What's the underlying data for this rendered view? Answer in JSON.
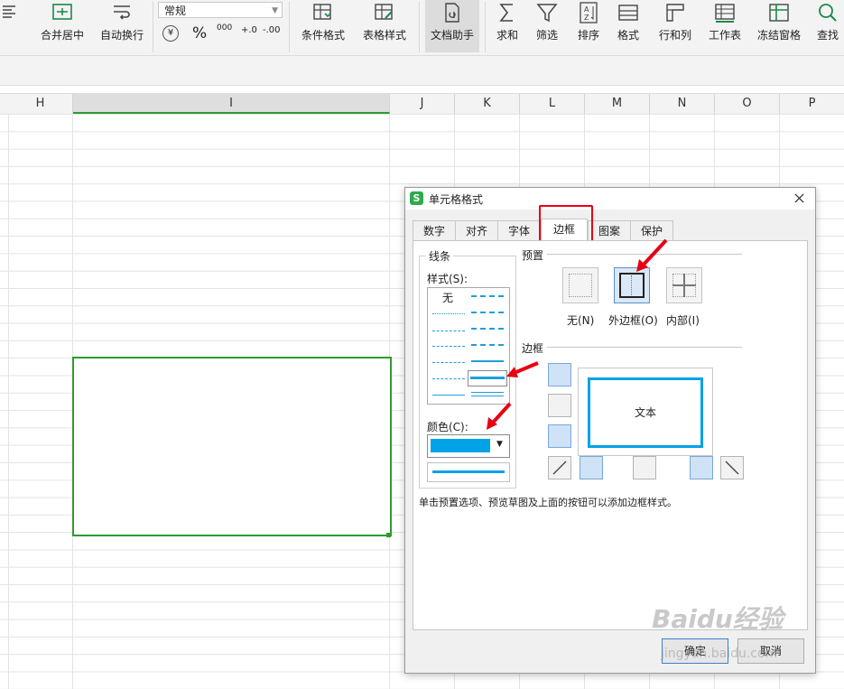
{
  "ribbon": {
    "merge_label": "合并居中",
    "wrap_label": "自动换行",
    "number_format": "常规",
    "currency_symbol": "¥",
    "percent_symbol": "%",
    "thousands_symbol": "000",
    "inc_decimal_symbol": "+.0",
    "dec_decimal_symbol": "-.00",
    "cond_format_label": "条件格式",
    "table_style_label": "表格样式",
    "doc_helper_label": "文档助手",
    "sum_label": "求和",
    "filter_label": "筛选",
    "sort_label": "排序",
    "format_label": "格式",
    "rowcol_label": "行和列",
    "sheet_label": "工作表",
    "freeze_label": "冻结窗格",
    "find_label": "查找"
  },
  "columns": [
    "H",
    "I",
    "J",
    "K",
    "L",
    "M",
    "N",
    "O",
    "P"
  ],
  "selection_color": "#2f9a2f",
  "dialog": {
    "title": "单元格格式",
    "tabs": [
      "数字",
      "对齐",
      "字体",
      "边框",
      "图案",
      "保护"
    ],
    "active_tab": "边框",
    "line_group": "线条",
    "style_label": "样式(S):",
    "style_none": "无",
    "color_label": "颜色(C):",
    "line_color": "#00a2e8",
    "preset_group": "预置",
    "preset_none": "无(N)",
    "preset_outline": "外边框(O)",
    "preset_inside": "内部(I)",
    "border_group": "边框",
    "preview_text": "文本",
    "hint": "单击预置选项、预览草图及上面的按钮可以添加边框样式。",
    "ok": "确定",
    "cancel": "取消"
  },
  "watermark": {
    "brand": "Baidu经验",
    "url": "jingyan.baidu.com"
  }
}
